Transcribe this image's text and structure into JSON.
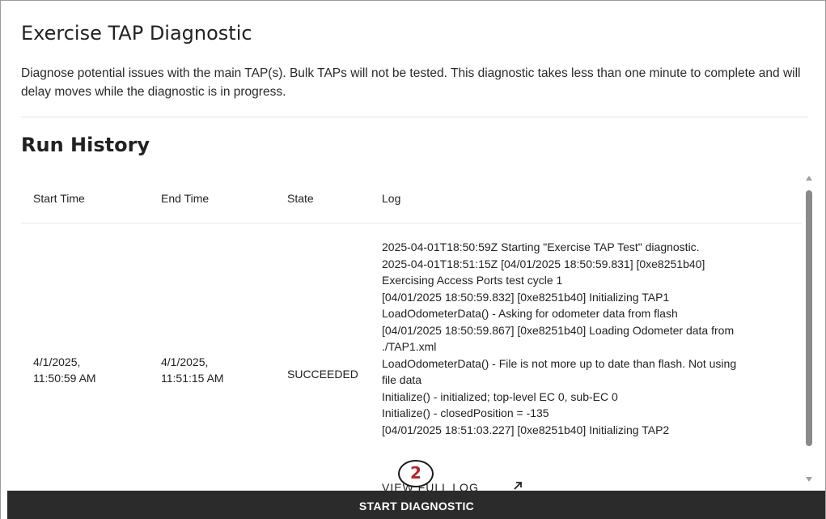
{
  "page": {
    "title": "Exercise TAP Diagnostic",
    "description": "Diagnose potential issues with the main TAP(s). Bulk TAPs will not be tested. This diagnostic takes less than one minute to complete and will delay moves while the diagnostic is in progress."
  },
  "run_history": {
    "title": "Run History",
    "columns": [
      "Start Time",
      "End Time",
      "State",
      "Log"
    ],
    "rows": [
      {
        "start_time_line1": "4/1/2025,",
        "start_time_line2": "11:50:59 AM",
        "end_time_line1": "4/1/2025,",
        "end_time_line2": "11:51:15 AM",
        "state": "SUCCEEDED",
        "log_lines": [
          "2025-04-01T18:50:59Z Starting \"Exercise TAP Test\" diagnostic.",
          "2025-04-01T18:51:15Z [04/01/2025 18:50:59.831] [0xe8251b40]",
          "Exercising Access Ports test cycle 1",
          "[04/01/2025 18:50:59.832] [0xe8251b40] Initializing TAP1",
          "LoadOdometerData() - Asking for odometer data from flash",
          "[04/01/2025 18:50:59.867] [0xe8251b40] Loading Odometer data from",
          "./TAP1.xml",
          "LoadOdometerData() - File is not more up to date than flash. Not using",
          "file data",
          "Initialize() - initialized; top-level EC 0, sub-EC 0",
          "Initialize() - closedPosition = -135",
          "[04/01/2025 18:51:03.227] [0xe8251b40] Initializing TAP2"
        ],
        "view_full_log_label": "VIEW FULL LOG",
        "view_full_log_icon": "external-link-icon"
      }
    ]
  },
  "callout": {
    "number": "2",
    "color": "#b3262b"
  },
  "actions": {
    "start_label": "START DIAGNOSTIC",
    "bar_color": "#2b2b2b"
  }
}
